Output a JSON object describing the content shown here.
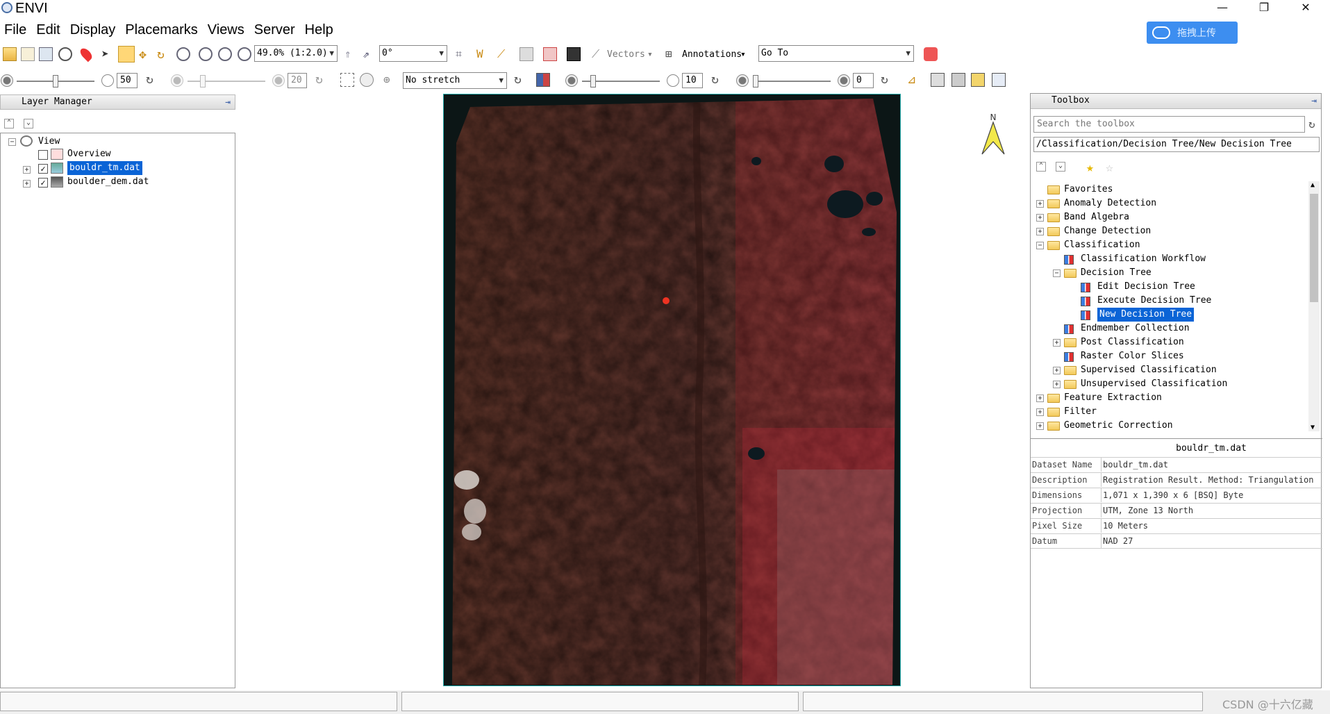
{
  "window": {
    "title": "ENVI"
  },
  "cloud_upload": {
    "label": "拖拽上传"
  },
  "menu": [
    "File",
    "Edit",
    "Display",
    "Placemarks",
    "Views",
    "Server",
    "Help"
  ],
  "toolbar1": {
    "zoom_value": "49.0% (1:2.0)",
    "rotation_value": "0°",
    "vectors_label": "Vectors",
    "annotations_label": "Annotations",
    "goto_value": "Go To"
  },
  "toolbar2": {
    "brightness_value": "50",
    "contrast_value": "20",
    "stretch_value": "No stretch",
    "sharpen_value": "10",
    "transparency_value": "0"
  },
  "layer_manager": {
    "title": "Layer Manager",
    "view_label": "View",
    "items": [
      {
        "label": "Overview",
        "checked": false
      },
      {
        "label": "bouldr_tm.dat",
        "checked": true,
        "selected": true
      },
      {
        "label": "boulder_dem.dat",
        "checked": true
      }
    ]
  },
  "toolbox": {
    "title": "Toolbox",
    "search_placeholder": "Search the toolbox",
    "path": "/Classification/Decision Tree/New Decision Tree",
    "tree": [
      {
        "label": "Favorites",
        "type": "folder",
        "level": 0,
        "expander": ""
      },
      {
        "label": "Anomaly Detection",
        "type": "folder",
        "level": 0,
        "expander": "+"
      },
      {
        "label": "Band Algebra",
        "type": "folder",
        "level": 0,
        "expander": "+"
      },
      {
        "label": "Change Detection",
        "type": "folder",
        "level": 0,
        "expander": "+"
      },
      {
        "label": "Classification",
        "type": "folder",
        "level": 0,
        "expander": "−"
      },
      {
        "label": "Classification Workflow",
        "type": "tool",
        "level": 1,
        "expander": ""
      },
      {
        "label": "Decision Tree",
        "type": "folder",
        "level": 1,
        "expander": "−"
      },
      {
        "label": "Edit Decision Tree",
        "type": "tool",
        "level": 2,
        "expander": ""
      },
      {
        "label": "Execute Decision Tree",
        "type": "tool",
        "level": 2,
        "expander": ""
      },
      {
        "label": "New Decision Tree",
        "type": "tool",
        "level": 2,
        "expander": "",
        "selected": true
      },
      {
        "label": "Endmember Collection",
        "type": "tool",
        "level": 1,
        "expander": ""
      },
      {
        "label": "Post Classification",
        "type": "folder",
        "level": 1,
        "expander": "+"
      },
      {
        "label": "Raster Color Slices",
        "type": "tool",
        "level": 1,
        "expander": ""
      },
      {
        "label": "Supervised Classification",
        "type": "folder",
        "level": 1,
        "expander": "+"
      },
      {
        "label": "Unsupervised Classification",
        "type": "folder",
        "level": 1,
        "expander": "+"
      },
      {
        "label": "Feature Extraction",
        "type": "folder",
        "level": 0,
        "expander": "+"
      },
      {
        "label": "Filter",
        "type": "folder",
        "level": 0,
        "expander": "+"
      },
      {
        "label": "Geometric Correction",
        "type": "folder",
        "level": 0,
        "expander": "+"
      }
    ]
  },
  "properties": {
    "title": "bouldr_tm.dat",
    "rows": [
      {
        "key": "Dataset Name",
        "value": "bouldr_tm.dat"
      },
      {
        "key": "Description",
        "value": "Registration Result. Method: Triangulation"
      },
      {
        "key": "Dimensions",
        "value": "1,071 x 1,390 x 6 [BSQ] Byte"
      },
      {
        "key": "Projection",
        "value": "UTM, Zone 13 North"
      },
      {
        "key": "Pixel Size",
        "value": "10 Meters"
      },
      {
        "key": "Datum",
        "value": "NAD 27"
      }
    ]
  },
  "north_arrow": {
    "label": "N"
  },
  "watermark": "CSDN @十六亿藏",
  "colors": {
    "selection": "#0a64d6",
    "image_red": "#b0202c",
    "image_base": "#5a3026"
  }
}
